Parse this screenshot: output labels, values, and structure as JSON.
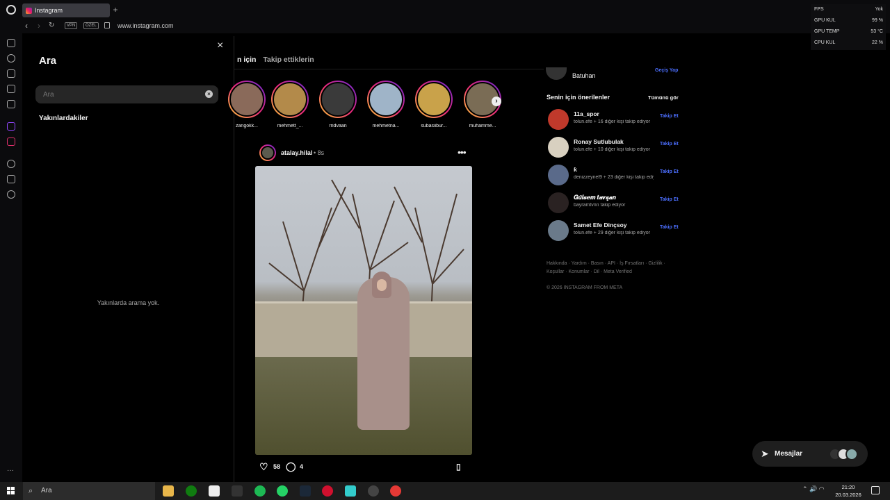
{
  "browser": {
    "tab_title": "Instagram",
    "new_tab": "+",
    "vpn_label": "VPN",
    "private_label": "ÖZEL",
    "url": "www.instagram.com"
  },
  "overlay_stats": [
    {
      "label": "FPS",
      "value": "Yok"
    },
    {
      "label": "GPU KUL",
      "value": "99 %"
    },
    {
      "label": "GPU TEMP",
      "value": "53 °C"
    },
    {
      "label": "CPU KUL",
      "value": "22 %"
    }
  ],
  "search_panel": {
    "title": "Ara",
    "placeholder": "Ara",
    "recent_title": "Yakınlardakiler",
    "no_recent": "Yakınlarda arama yok.",
    "close": "×"
  },
  "feed": {
    "tabs": [
      "n için",
      "Takip ettiklerin"
    ],
    "stories": [
      {
        "name": "zangokk...",
        "color": "#8a6a5a"
      },
      {
        "name": "mehmett_...",
        "color": "#b38a4a"
      },
      {
        "name": "rridvaan",
        "color": "#3a3a3a"
      },
      {
        "name": "mehmetna...",
        "color": "#9fb4c8"
      },
      {
        "name": "subasiibur...",
        "color": "#c9a24a"
      },
      {
        "name": "muhamme...",
        "color": "#7a6c55"
      }
    ],
    "post": {
      "user": "atalay.hilal",
      "time": "• 8s",
      "likes": "58",
      "comments": "4"
    }
  },
  "right_column": {
    "current_user": "Batuhan",
    "switch_label": "Geçiş Yap",
    "suggest_title": "Senin için önerilenler",
    "see_all": "Tümünü gör",
    "follow_label": "Takip Et",
    "suggestions": [
      {
        "username": "11a_spor",
        "sub": "tolun.efe + 16 diğer kişi takip ediyor",
        "color": "#c0392b"
      },
      {
        "username": "Ronay Sutlubulak",
        "sub": "tolun.efe + 10 diğer kişi takip ediyor",
        "color": "#d8d0c0"
      },
      {
        "username": "ƙ",
        "sub": "denizzeynel9 + 23 diğer kişi takip ediyor",
        "color": "#5a6a8a"
      },
      {
        "username": "𝑮𝒖̈𝒍𝒔𝒆𝒎 𝒕𝒂𝒗𝒔̧𝒂𝒏",
        "sub": "bayramtvnn takip ediyor",
        "color": "#2a2222"
      },
      {
        "username": "Samet Efe Dinçsoy",
        "sub": "tolun.efe + 29 diğer kişi takip ediyor",
        "color": "#6a7a8a"
      }
    ],
    "footer": "Hakkında · Yardım · Basın · API · İş Fırsatları · Gizlilik · Koşullar · Konumlar · Dil · Meta Verified",
    "copyright": "© 2026 INSTAGRAM FROM META"
  },
  "messages": {
    "label": "Mesajlar"
  },
  "taskbar": {
    "search": "Ara",
    "time": "21:20",
    "date": "20.03.2026"
  }
}
